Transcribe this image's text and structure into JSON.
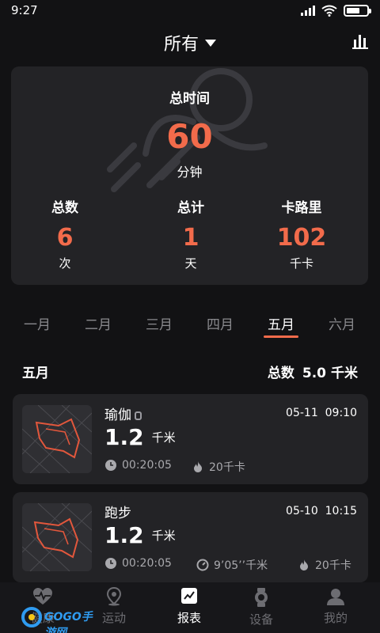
{
  "status_bar": {
    "time": "9:27",
    "battery_icon": "battery-icon",
    "wifi_icon": "wifi-icon",
    "signal_icon": "signal-icon"
  },
  "header": {
    "filter_label": "所有",
    "chart_icon": "bar-chart-icon"
  },
  "summary": {
    "total_time_label": "总时间",
    "total_time_value": "60",
    "total_time_unit": "分钟",
    "stats": [
      {
        "label": "总数",
        "value": "6",
        "unit": "次"
      },
      {
        "label": "总计",
        "value": "1",
        "unit": "天"
      },
      {
        "label": "卡路里",
        "value": "102",
        "unit": "千卡"
      }
    ]
  },
  "months": {
    "items": [
      "一月",
      "二月",
      "三月",
      "四月",
      "五月",
      "六月"
    ],
    "selected": "五月"
  },
  "section": {
    "title": "五月",
    "total_label": "总数",
    "total_value": "5.0",
    "total_unit": "千米"
  },
  "activities": [
    {
      "name": "瑜伽",
      "date": "05-11",
      "time": "09:10",
      "distance": "1.2",
      "distance_unit": "千米",
      "duration": "00:20:05",
      "calories": "20千卡",
      "has_watch": true
    },
    {
      "name": "跑步",
      "date": "05-10",
      "time": "10:15",
      "distance": "1.2",
      "distance_unit": "千米",
      "duration": "00:20:05",
      "pace": "9’05’’千米",
      "calories": "20千卡",
      "has_watch": false
    }
  ],
  "nav": {
    "items": [
      {
        "label": "健康",
        "icon": "heart-rate-icon"
      },
      {
        "label": "运动",
        "icon": "location-pin-icon"
      },
      {
        "label": "报表",
        "icon": "report-chart-icon"
      },
      {
        "label": "设备",
        "icon": "watch-icon"
      },
      {
        "label": "我的",
        "icon": "profile-icon"
      }
    ],
    "active": "报表"
  },
  "watermark": {
    "text": "GOGO手游网"
  },
  "colors": {
    "background": "#121214",
    "card": "#232326",
    "accent": "#f26b4b",
    "muted": "#8a8a8e"
  }
}
